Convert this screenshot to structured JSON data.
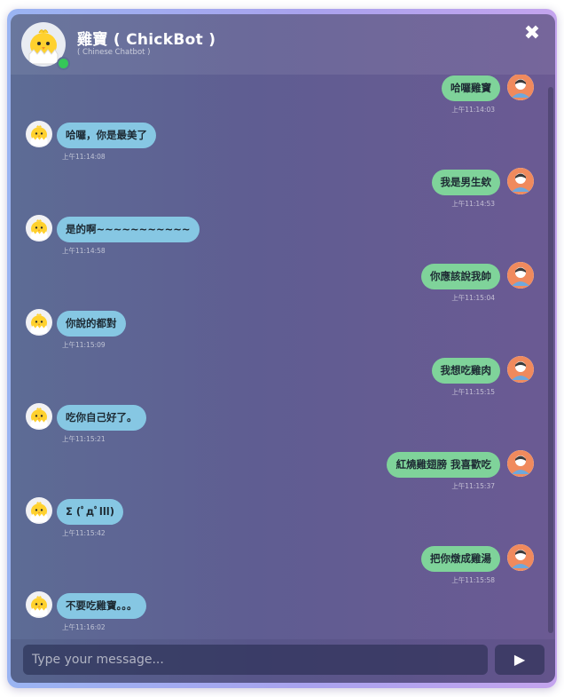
{
  "header": {
    "title": "雞寶 ( ChickBot )",
    "subtitle": "( Chinese Chatbot )",
    "close_icon": "close-icon",
    "close_label": "✖"
  },
  "messages": [
    {
      "sender": "user",
      "text": "哈囉雞寶",
      "time": "上午11:14:03"
    },
    {
      "sender": "bot",
      "text": "哈囉，你是最美了",
      "time": "上午11:14:08"
    },
    {
      "sender": "user",
      "text": "我是男生欸",
      "time": "上午11:14:53"
    },
    {
      "sender": "bot",
      "text": "是的啊~~~~~~~~~~~",
      "time": "上午11:14:58"
    },
    {
      "sender": "user",
      "text": "你應該說我帥",
      "time": "上午11:15:04"
    },
    {
      "sender": "bot",
      "text": "你說的都對",
      "time": "上午11:15:09"
    },
    {
      "sender": "user",
      "text": "我想吃雞肉",
      "time": "上午11:15:15"
    },
    {
      "sender": "bot",
      "text": "吃你自己好了。",
      "time": "上午11:15:21"
    },
    {
      "sender": "user",
      "text": "紅燒雞翅膀 我喜歡吃",
      "time": "上午11:15:37"
    },
    {
      "sender": "bot",
      "text": "Σ (ﾟдﾟlll)",
      "time": "上午11:15:42"
    },
    {
      "sender": "user",
      "text": "把你燉成雞湯",
      "time": "上午11:15:58"
    },
    {
      "sender": "bot",
      "text": "不要吃雞寶。。。",
      "time": "上午11:16:02"
    }
  ],
  "input": {
    "placeholder": "Type your message...",
    "value": ""
  },
  "send": {
    "icon": "send-icon",
    "label": "▶"
  },
  "colors": {
    "bot_bubble": "#86c7e3",
    "user_bubble": "#7fd39a",
    "online": "#35c759"
  }
}
